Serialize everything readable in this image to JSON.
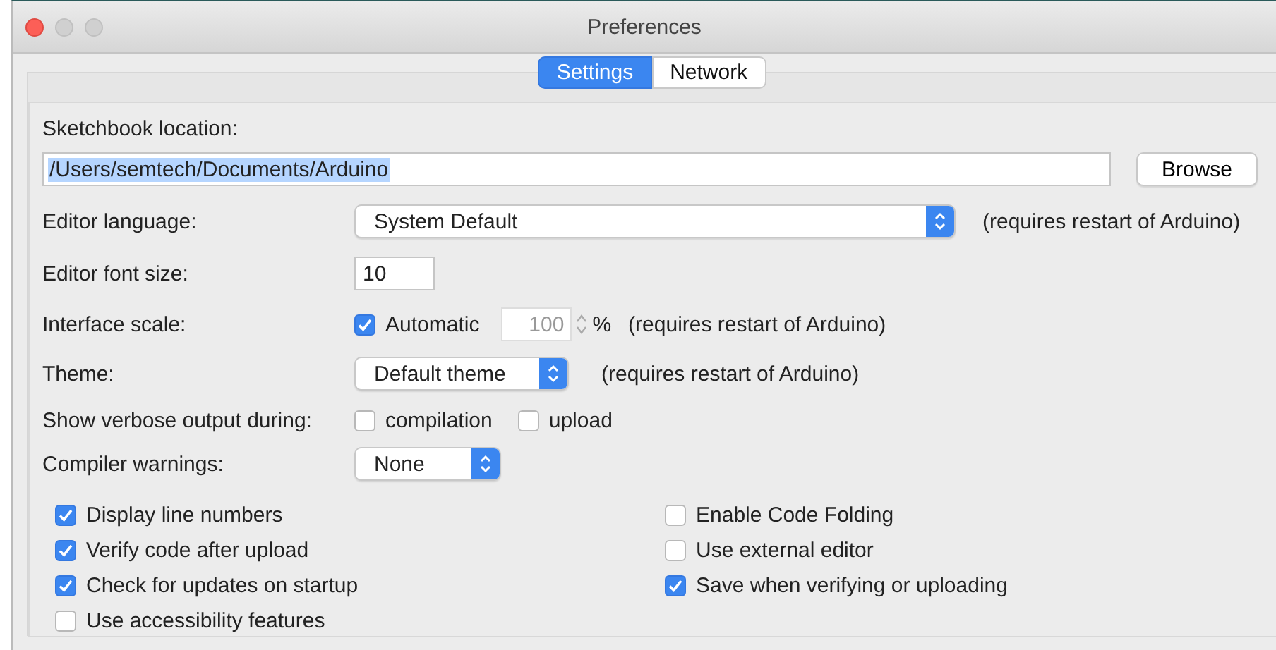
{
  "window": {
    "title": "Preferences"
  },
  "tabs": [
    {
      "label": "Settings",
      "selected": true
    },
    {
      "label": "Network",
      "selected": false
    }
  ],
  "sketchbook": {
    "label": "Sketchbook location:",
    "value": "/Users/semtech/Documents/Arduino",
    "value_selected": true,
    "button": "Browse"
  },
  "editor_language": {
    "label": "Editor language:",
    "value": "System Default",
    "note": "(requires restart of Arduino)"
  },
  "font_size": {
    "label": "Editor font size:",
    "value": "10"
  },
  "interface_scale": {
    "label": "Interface scale:",
    "automatic": {
      "label": "Automatic",
      "checked": true
    },
    "value": "100",
    "disabled": true,
    "unit": "%",
    "note": "(requires restart of Arduino)"
  },
  "theme": {
    "label": "Theme:",
    "value": "Default theme",
    "note": "(requires restart of Arduino)"
  },
  "verbose": {
    "label": "Show verbose output during:",
    "options": [
      {
        "label": "compilation",
        "checked": false
      },
      {
        "label": "upload",
        "checked": false
      }
    ]
  },
  "compiler_warnings": {
    "label": "Compiler warnings:",
    "value": "None"
  },
  "options": {
    "left": [
      {
        "label": "Display line numbers",
        "checked": true
      },
      {
        "label": "Verify code after upload",
        "checked": true
      },
      {
        "label": "Check for updates on startup",
        "checked": true
      },
      {
        "label": "Use accessibility features",
        "checked": false
      }
    ],
    "right": [
      {
        "label": "Enable Code Folding",
        "checked": false
      },
      {
        "label": "Use external editor",
        "checked": false
      },
      {
        "label": "Save when verifying or uploading",
        "checked": true
      }
    ]
  }
}
